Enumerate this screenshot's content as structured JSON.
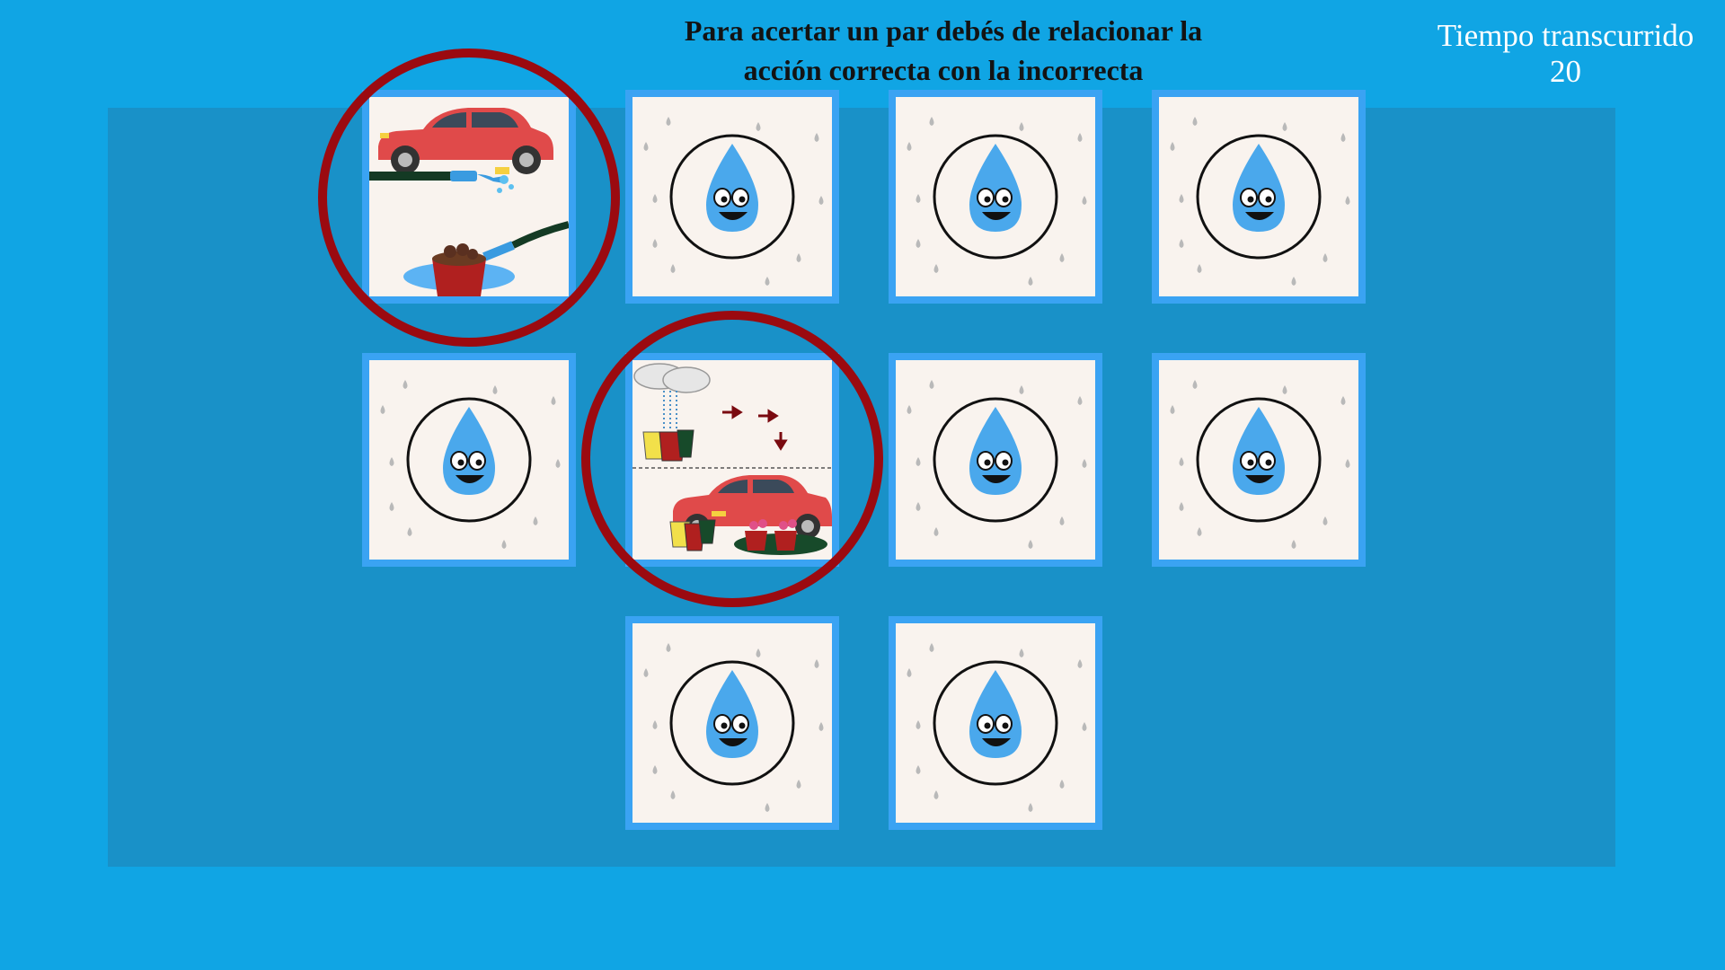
{
  "instructions": {
    "line1": "Para acertar un par debés de relacionar la",
    "line2": "acción correcta con la incorrecta"
  },
  "timer": {
    "label": "Tiempo transcurrido",
    "value": "20"
  },
  "colors": {
    "background": "#10a5e4",
    "board": "#1991c8",
    "card_border": "#3aa3f3",
    "card_face": "#f9f3ee",
    "drop": "#4aa8ec",
    "selection_ring": "#9b0a10",
    "car": "#e04a4a"
  },
  "cards": [
    {
      "id": "card-1",
      "state": "revealed",
      "image": "car-washing-with-hose",
      "selected": true
    },
    {
      "id": "card-2",
      "state": "hidden",
      "image": "water-drop-mascot"
    },
    {
      "id": "card-3",
      "state": "hidden",
      "image": "water-drop-mascot"
    },
    {
      "id": "card-4",
      "state": "hidden",
      "image": "water-drop-mascot"
    },
    {
      "id": "card-5",
      "state": "hidden",
      "image": "water-drop-mascot"
    },
    {
      "id": "card-6",
      "state": "revealed",
      "image": "rainwater-buckets-car-washing",
      "selected": true
    },
    {
      "id": "card-7",
      "state": "hidden",
      "image": "water-drop-mascot"
    },
    {
      "id": "card-8",
      "state": "hidden",
      "image": "water-drop-mascot"
    },
    {
      "id": "card-9",
      "state": "hidden",
      "image": "water-drop-mascot"
    },
    {
      "id": "card-10",
      "state": "hidden",
      "image": "water-drop-mascot"
    }
  ]
}
